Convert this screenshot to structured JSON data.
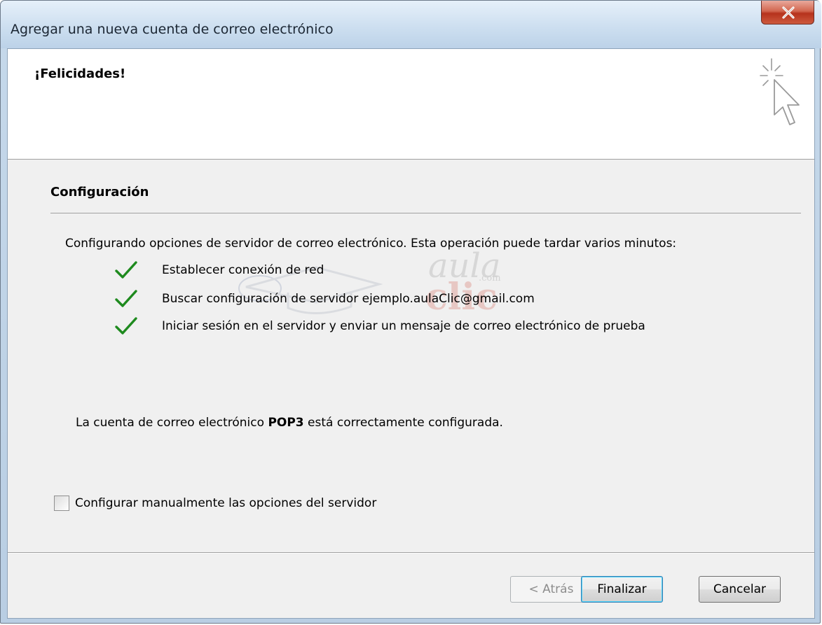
{
  "window": {
    "title": "Agregar una nueva cuenta de correo electrónico",
    "close_icon": "close-x-icon"
  },
  "header": {
    "title": "¡Felicidades!",
    "icon": "wizard-sparkle-cursor-icon"
  },
  "section": {
    "title": "Configuración",
    "intro": "Configurando opciones de servidor de correo electrónico. Esta operación puede tardar varios minutos:"
  },
  "tasks": [
    {
      "label": "Establecer conexión de red",
      "status": "done",
      "icon": "checkmark-icon"
    },
    {
      "label": "Buscar configuración de servidor ejemplo.aulaClic@gmail.com",
      "status": "done",
      "icon": "checkmark-icon"
    },
    {
      "label": "Iniciar sesión en el servidor y enviar un mensaje de correo electrónico de prueba",
      "status": "done",
      "icon": "checkmark-icon"
    }
  ],
  "watermark": {
    "line1": "aula",
    "line2": "clic",
    "small": ".com"
  },
  "result": {
    "prefix": "La cuenta de correo electrónico ",
    "protocol": "POP3",
    "suffix": " está correctamente configurada."
  },
  "manual_config": {
    "label": "Configurar manualmente las opciones del servidor",
    "checked": false
  },
  "buttons": {
    "back": "< Atrás",
    "finish": "Finalizar",
    "cancel": "Cancelar"
  },
  "colors": {
    "check_green": "#1e8a1e",
    "close_red": "#c8462e",
    "title_bar": "#cddff0"
  }
}
